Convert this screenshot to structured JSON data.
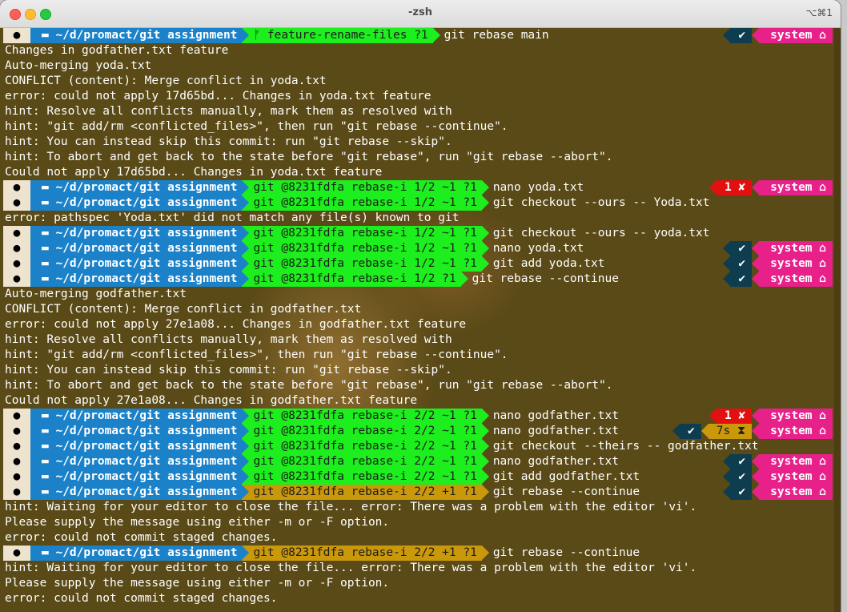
{
  "window": {
    "title": "-zsh",
    "shortcut": "⌥⌘1"
  },
  "colors": {
    "dir": "#1b82c9",
    "git_clean": "#1dee1d",
    "git_busy": "#c9980b",
    "status_ok": "#0e3d4f",
    "status_err": "#e21010",
    "system": "#e8208a",
    "background": "#5a4a17"
  },
  "lines": [
    {
      "type": "prompt",
      "dir": "~/d/promact/git assignment",
      "git": "ᚠ feature-rename-files ?1",
      "git_state": "ok",
      "cmd": "git rebase main",
      "right": {
        "status": "✔",
        "status_type": "ok",
        "system": "system ⌂"
      }
    },
    {
      "type": "text",
      "text": "Changes in godfather.txt feature"
    },
    {
      "type": "text",
      "text": "Auto-merging yoda.txt"
    },
    {
      "type": "text",
      "text": "CONFLICT (content): Merge conflict in yoda.txt"
    },
    {
      "type": "text",
      "text": "error: could not apply 17d65bd... Changes in yoda.txt feature"
    },
    {
      "type": "text",
      "text": "hint: Resolve all conflicts manually, mark them as resolved with"
    },
    {
      "type": "text",
      "text": "hint: \"git add/rm <conflicted_files>\", then run \"git rebase --continue\"."
    },
    {
      "type": "text",
      "text": "hint: You can instead skip this commit: run \"git rebase --skip\"."
    },
    {
      "type": "text",
      "text": "hint: To abort and get back to the state before \"git rebase\", run \"git rebase --abort\"."
    },
    {
      "type": "text",
      "text": "Could not apply 17d65bd... Changes in yoda.txt feature"
    },
    {
      "type": "prompt",
      "dir": "~/d/promact/git assignment",
      "git": "git @8231fdfa rebase-i 1/2 ~1 ?1",
      "git_state": "ok",
      "cmd": "nano yoda.txt",
      "right": {
        "status": "1 ✘",
        "status_type": "err",
        "system": "system ⌂"
      }
    },
    {
      "type": "prompt",
      "dir": "~/d/promact/git assignment",
      "git": "git @8231fdfa rebase-i 1/2 ~1 ?1",
      "git_state": "ok",
      "cmd": "git checkout --ours -- Yoda.txt",
      "right": null
    },
    {
      "type": "text",
      "text": "error: pathspec 'Yoda.txt' did not match any file(s) known to git"
    },
    {
      "type": "prompt",
      "dir": "~/d/promact/git assignment",
      "git": "git @8231fdfa rebase-i 1/2 ~1 ?1",
      "git_state": "ok",
      "cmd": "git checkout --ours -- yoda.txt",
      "right": null
    },
    {
      "type": "prompt",
      "dir": "~/d/promact/git assignment",
      "git": "git @8231fdfa rebase-i 1/2 ~1 ?1",
      "git_state": "ok",
      "cmd": "nano yoda.txt",
      "right": {
        "status": "✔",
        "status_type": "ok",
        "system": "system ⌂"
      }
    },
    {
      "type": "prompt",
      "dir": "~/d/promact/git assignment",
      "git": "git @8231fdfa rebase-i 1/2 ~1 ?1",
      "git_state": "ok",
      "cmd": "git add yoda.txt",
      "right": {
        "status": "✔",
        "status_type": "ok",
        "system": "system ⌂"
      }
    },
    {
      "type": "prompt",
      "dir": "~/d/promact/git assignment",
      "git": "git @8231fdfa rebase-i 1/2 ?1",
      "git_state": "ok",
      "cmd": "git rebase --continue",
      "right": {
        "status": "✔",
        "status_type": "ok",
        "system": "system ⌂"
      }
    },
    {
      "type": "text",
      "text": "Auto-merging godfather.txt"
    },
    {
      "type": "text",
      "text": "CONFLICT (content): Merge conflict in godfather.txt"
    },
    {
      "type": "text",
      "text": "error: could not apply 27e1a08... Changes in godfather.txt feature"
    },
    {
      "type": "text",
      "text": "hint: Resolve all conflicts manually, mark them as resolved with"
    },
    {
      "type": "text",
      "text": "hint: \"git add/rm <conflicted_files>\", then run \"git rebase --continue\"."
    },
    {
      "type": "text",
      "text": "hint: You can instead skip this commit: run \"git rebase --skip\"."
    },
    {
      "type": "text",
      "text": "hint: To abort and get back to the state before \"git rebase\", run \"git rebase --abort\"."
    },
    {
      "type": "text",
      "text": "Could not apply 27e1a08... Changes in godfather.txt feature"
    },
    {
      "type": "prompt",
      "dir": "~/d/promact/git assignment",
      "git": "git @8231fdfa rebase-i 2/2 ~1 ?1",
      "git_state": "ok",
      "cmd": "nano godfather.txt",
      "right": {
        "status": "1 ✘",
        "status_type": "err",
        "system": "system ⌂"
      }
    },
    {
      "type": "prompt",
      "dir": "~/d/promact/git assignment",
      "git": "git @8231fdfa rebase-i 2/2 ~1 ?1",
      "git_state": "ok",
      "cmd": "nano godfather.txt",
      "right": {
        "status": "✔",
        "status_type": "ok",
        "time": "7s ⧗",
        "system": "system ⌂"
      }
    },
    {
      "type": "prompt",
      "dir": "~/d/promact/git assignment",
      "git": "git @8231fdfa rebase-i 2/2 ~1 ?1",
      "git_state": "ok",
      "cmd": "git checkout --theirs -- godfather.txt",
      "right": null
    },
    {
      "type": "prompt",
      "dir": "~/d/promact/git assignment",
      "git": "git @8231fdfa rebase-i 2/2 ~1 ?1",
      "git_state": "ok",
      "cmd": "nano godfather.txt",
      "right": {
        "status": "✔",
        "status_type": "ok",
        "system": "system ⌂"
      }
    },
    {
      "type": "prompt",
      "dir": "~/d/promact/git assignment",
      "git": "git @8231fdfa rebase-i 2/2 ~1 ?1",
      "git_state": "ok",
      "cmd": "git add godfather.txt",
      "right": {
        "status": "✔",
        "status_type": "ok",
        "system": "system ⌂"
      }
    },
    {
      "type": "prompt",
      "dir": "~/d/promact/git assignment",
      "git": "git @8231fdfa rebase-i 2/2 +1 ?1",
      "git_state": "busy",
      "cmd": "git rebase --continue",
      "right": {
        "status": "✔",
        "status_type": "ok",
        "system": "system ⌂"
      }
    },
    {
      "type": "text",
      "text": "hint: Waiting for your editor to close the file... error: There was a problem with the editor 'vi'."
    },
    {
      "type": "text",
      "text": "Please supply the message using either -m or -F option."
    },
    {
      "type": "text",
      "text": "error: could not commit staged changes."
    },
    {
      "type": "prompt",
      "dir": "~/d/promact/git assignment",
      "git": "git @8231fdfa rebase-i 2/2 +1 ?1",
      "git_state": "busy",
      "cmd": "git rebase --continue",
      "right": null
    },
    {
      "type": "text",
      "text": "hint: Waiting for your editor to close the file... error: There was a problem with the editor 'vi'."
    },
    {
      "type": "text",
      "text": "Please supply the message using either -m or -F option."
    },
    {
      "type": "text",
      "text": "error: could not commit staged changes."
    }
  ]
}
